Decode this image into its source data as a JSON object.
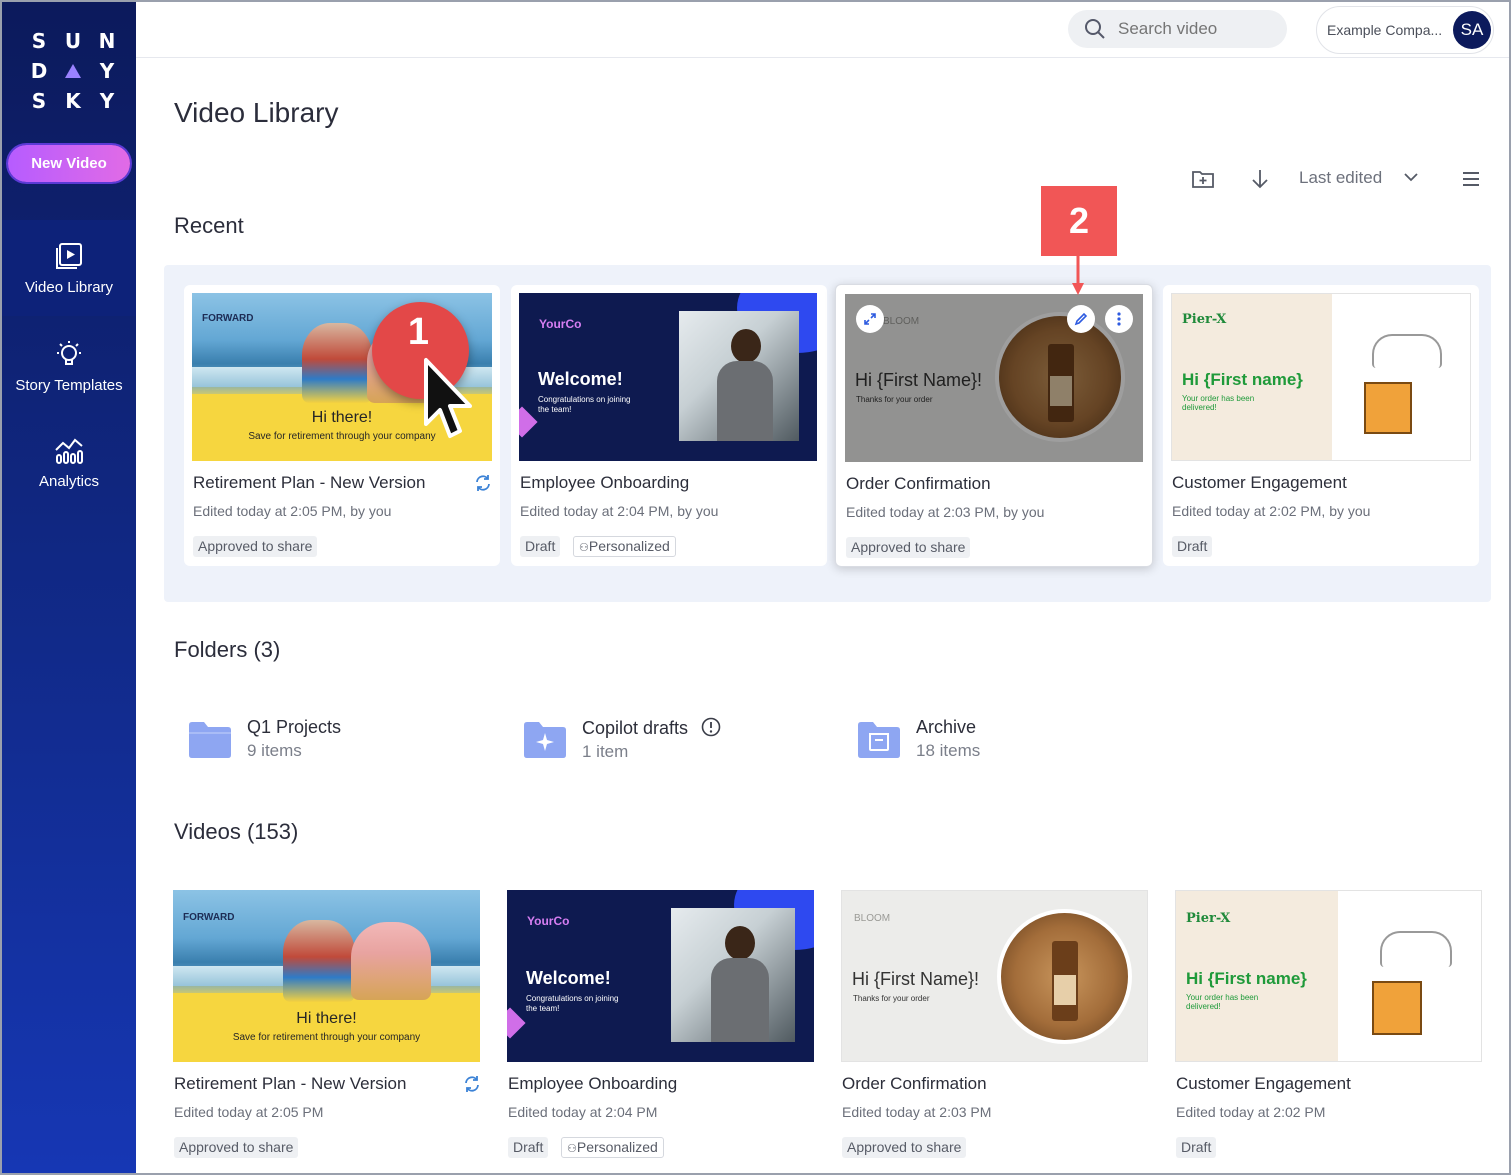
{
  "brand": {
    "logo_letters": [
      "S",
      "U",
      "N",
      "D",
      "Y",
      "S",
      "K",
      "Y"
    ]
  },
  "sidebar": {
    "new_video_label": "New Video",
    "items": [
      {
        "label": "Video Library",
        "icon": "video-library-icon",
        "active": true
      },
      {
        "label": "Story Templates",
        "icon": "lightbulb-icon",
        "active": false
      },
      {
        "label": "Analytics",
        "icon": "analytics-icon",
        "active": false
      }
    ]
  },
  "topbar": {
    "search_placeholder": "Search video",
    "account_name": "Example Compa...",
    "avatar_initials": "SA"
  },
  "page": {
    "title": "Video Library"
  },
  "toolbar": {
    "sort_label": "Last edited"
  },
  "recent": {
    "title": "Recent",
    "cards": [
      {
        "title": "Retirement Plan - New Version",
        "meta": "Edited today at 2:05 PM, by you",
        "tags": [
          "Approved to share"
        ],
        "thumb_text": "Hi there!",
        "thumb_sub": "Save for retirement through your company",
        "thumb_brand": "FORWARD"
      },
      {
        "title": "Employee Onboarding",
        "meta": "Edited today at 2:04 PM, by you",
        "tags": [
          "Draft",
          "Personalized"
        ],
        "thumb_text": "Welcome!",
        "thumb_sub": "Congratulations on joining the team!",
        "thumb_brand": "YourCo"
      },
      {
        "title": "Order Confirmation",
        "meta": "Edited today at 2:03 PM, by you",
        "tags": [
          "Approved to share"
        ],
        "thumb_text": "Hi {First Name}!",
        "thumb_sub": "Thanks for your order",
        "thumb_brand": "BLOOM"
      },
      {
        "title": "Customer Engagement",
        "meta": "Edited today at 2:02 PM, by you",
        "tags": [
          "Draft"
        ],
        "thumb_text": "Hi {First name}",
        "thumb_sub": "Your order has been delivered!",
        "thumb_brand": "Pier-X"
      }
    ]
  },
  "folders": {
    "title": "Folders (3)",
    "items": [
      {
        "name": "Q1 Projects",
        "count": "9 items"
      },
      {
        "name": "Copilot drafts",
        "count": "1 item"
      },
      {
        "name": "Archive",
        "count": "18 items"
      }
    ]
  },
  "videos": {
    "title": "Videos (153)",
    "cards": [
      {
        "title": "Retirement Plan - New Version",
        "meta": "Edited today at 2:05 PM",
        "tags": [
          "Approved to share"
        ]
      },
      {
        "title": "Employee Onboarding",
        "meta": "Edited today at 2:04 PM",
        "tags": [
          "Draft",
          "Personalized"
        ]
      },
      {
        "title": "Order Confirmation",
        "meta": "Edited today at 2:03 PM",
        "tags": [
          "Approved to share"
        ]
      },
      {
        "title": "Customer Engagement",
        "meta": "Edited today at 2:02 PM",
        "tags": [
          "Draft"
        ]
      }
    ]
  },
  "annotations": {
    "step1": "1",
    "step2": "2"
  },
  "colors": {
    "sidebar": "#0c1a5c",
    "accent": "#b65cff",
    "callout": "#e34848",
    "folder": "#8ea6f2"
  }
}
